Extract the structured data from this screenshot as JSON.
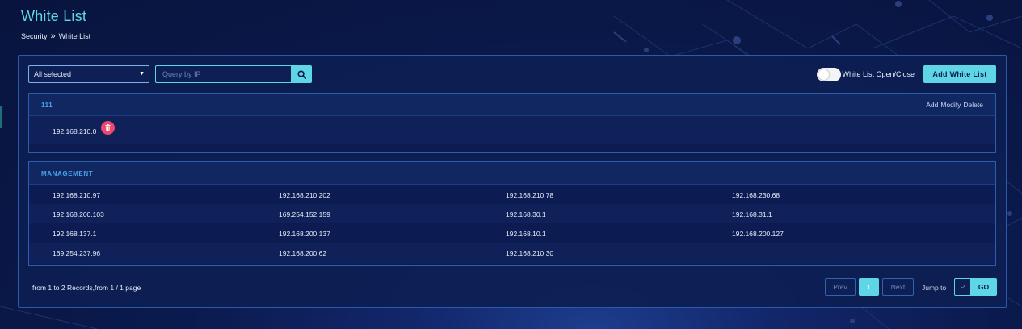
{
  "page": {
    "title": "White List"
  },
  "breadcrumb": {
    "parent": "Security",
    "separator": "»",
    "current": "White List"
  },
  "toolbar": {
    "group_select": {
      "value": "All selected"
    },
    "search": {
      "placeholder": "Query by IP",
      "icon": "search-icon"
    },
    "toggle": {
      "label": "White List Open/Close",
      "enabled": false
    },
    "add_label": "Add White List"
  },
  "groups": [
    {
      "name": "111",
      "actions": [
        "Add",
        "Modify",
        "Delete"
      ],
      "ips": [
        "192.168.210.0"
      ]
    },
    {
      "name": "MANAGEMENT",
      "actions": [],
      "ips": [
        "192.168.210.97",
        "192.168.210.202",
        "192.168.210.78",
        "192.168.230.68",
        "192.168.200.103",
        "169.254.152.159",
        "192.168.30.1",
        "192.168.31.1",
        "192.168.137.1",
        "192.168.200.137",
        "192.168.10.1",
        "192.168.200.127",
        "169.254.237.96",
        "192.168.200.62",
        "192.168.210.30"
      ]
    }
  ],
  "footer": {
    "records_text": "from 1 to 2 Records,from 1 / 1 page",
    "pagination": {
      "prev": "Prev",
      "current_page": "1",
      "next": "Next"
    },
    "jump": {
      "label": "Jump to",
      "placeholder": "P",
      "go": "GO"
    }
  },
  "colors": {
    "accent": "#5fd6e6",
    "group_title": "#4aa3ea",
    "delete": "#f0476e",
    "background": "#0b1a4e"
  }
}
